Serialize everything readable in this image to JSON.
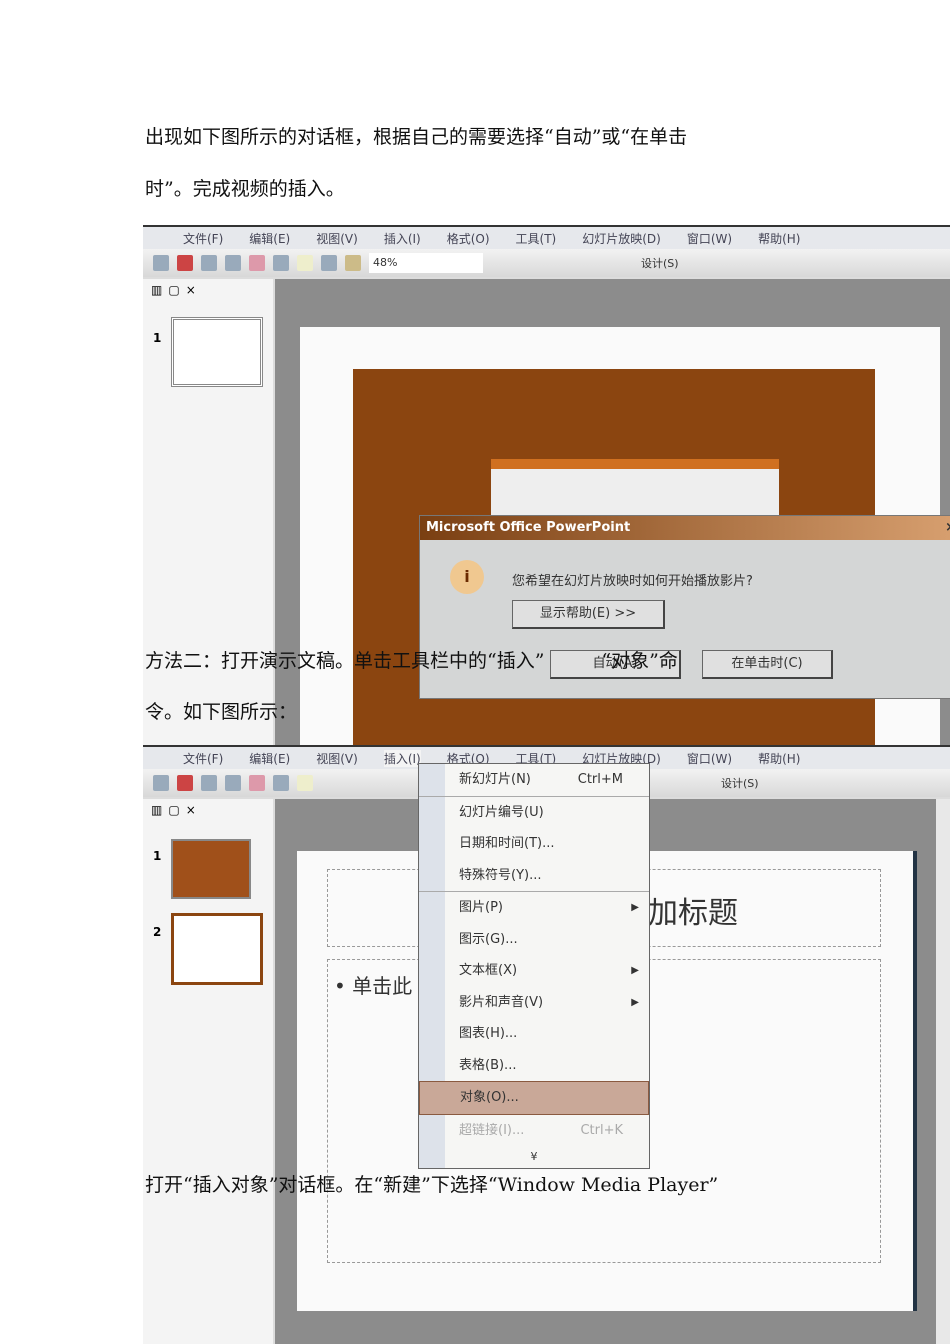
{
  "text": {
    "para1_line1": "出现如下图所示的对话框，根据自己的需要选择“自动”或“在单击",
    "para1_line2": "时”。完成视频的插入。",
    "para2_line1": "方法二：打开演示文稿。单击工具栏中的“插入”　　　“对象”命",
    "para2_line2": "令。如下图所示：",
    "para3": "打开“插入对象”对话框。在“新建”下选择“Window Media Player”"
  },
  "app": {
    "menus": [
      "文件(F)",
      "编辑(E)",
      "视图(V)",
      "插入(I)",
      "格式(O)",
      "工具(T)",
      "幻灯片放映(D)",
      "窗口(W)",
      "帮助(H)"
    ],
    "zoom": "48%",
    "design": "设计(S)",
    "close": "×",
    "slide_numbers": [
      "1",
      "2"
    ]
  },
  "dialog": {
    "title": "Microsoft Office PowerPoint",
    "message": "您希望在幻灯片放映时如何开始播放影片?",
    "help_button": "显示帮助(E) >>",
    "auto_button": "自动(A)",
    "click_button": "在单击时(C)",
    "close": "×"
  },
  "insert_menu": {
    "items": [
      {
        "label": "新幻灯片(N)",
        "shortcut": "Ctrl+M"
      },
      {
        "label": "幻灯片编号(U)"
      },
      {
        "label": "日期和时间(T)..."
      },
      {
        "label": "特殊符号(Y)..."
      },
      {
        "label": "图片(P)",
        "submenu": "▶"
      },
      {
        "label": "图示(G)..."
      },
      {
        "label": "文本框(X)",
        "submenu": "▶"
      },
      {
        "label": "影片和声音(V)",
        "submenu": "▶"
      },
      {
        "label": "图表(H)..."
      },
      {
        "label": "表格(B)..."
      },
      {
        "label": "对象(O)..."
      },
      {
        "label": "超链接(I)...",
        "shortcut": "Ctrl+K"
      }
    ],
    "more": "¥"
  },
  "slide2": {
    "title_fragment": "加标题",
    "bullet_fragment": "• 单击此"
  }
}
